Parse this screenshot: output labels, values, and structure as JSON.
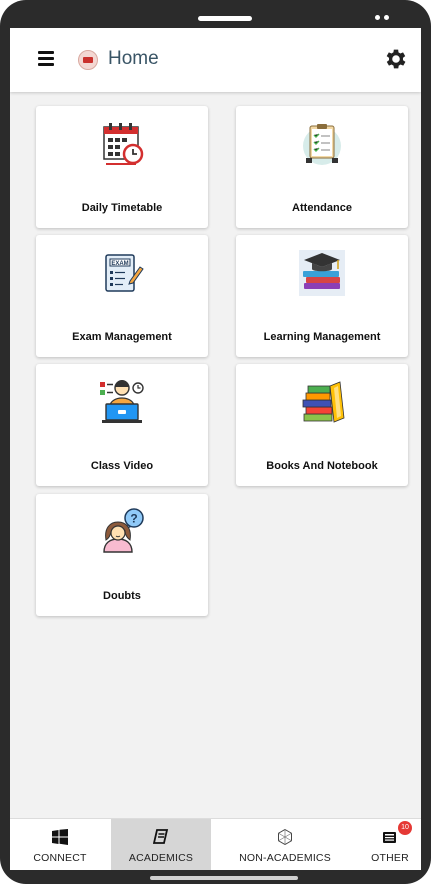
{
  "appbar": {
    "title": "Home"
  },
  "cards": [
    {
      "label": "Daily Timetable",
      "icon": "timetable-calendar-icon"
    },
    {
      "label": "Attendance",
      "icon": "attendance-clipboard-icon"
    },
    {
      "label": "Exam Management",
      "icon": "exam-paper-icon"
    },
    {
      "label": "Learning Management",
      "icon": "books-graduation-cap-icon"
    },
    {
      "label": "Class Video",
      "icon": "video-class-laptop-icon"
    },
    {
      "label": "Books And Notebook",
      "icon": "books-stack-icon"
    },
    {
      "label": "Doubts",
      "icon": "question-person-icon"
    }
  ],
  "nav": [
    {
      "label": "CONNECT",
      "icon": "windows-grid-icon"
    },
    {
      "label": "ACADEMICS",
      "icon": "book-icon",
      "active": true
    },
    {
      "label": "NON-ACADEMICS",
      "icon": "polygon-icon"
    },
    {
      "label": "OTHER",
      "icon": "news-icon",
      "badge": "10"
    }
  ],
  "colors": {
    "accent_red": "#e53935",
    "title_color": "#3a5566",
    "active_tab_bg": "#d6d6d6"
  }
}
